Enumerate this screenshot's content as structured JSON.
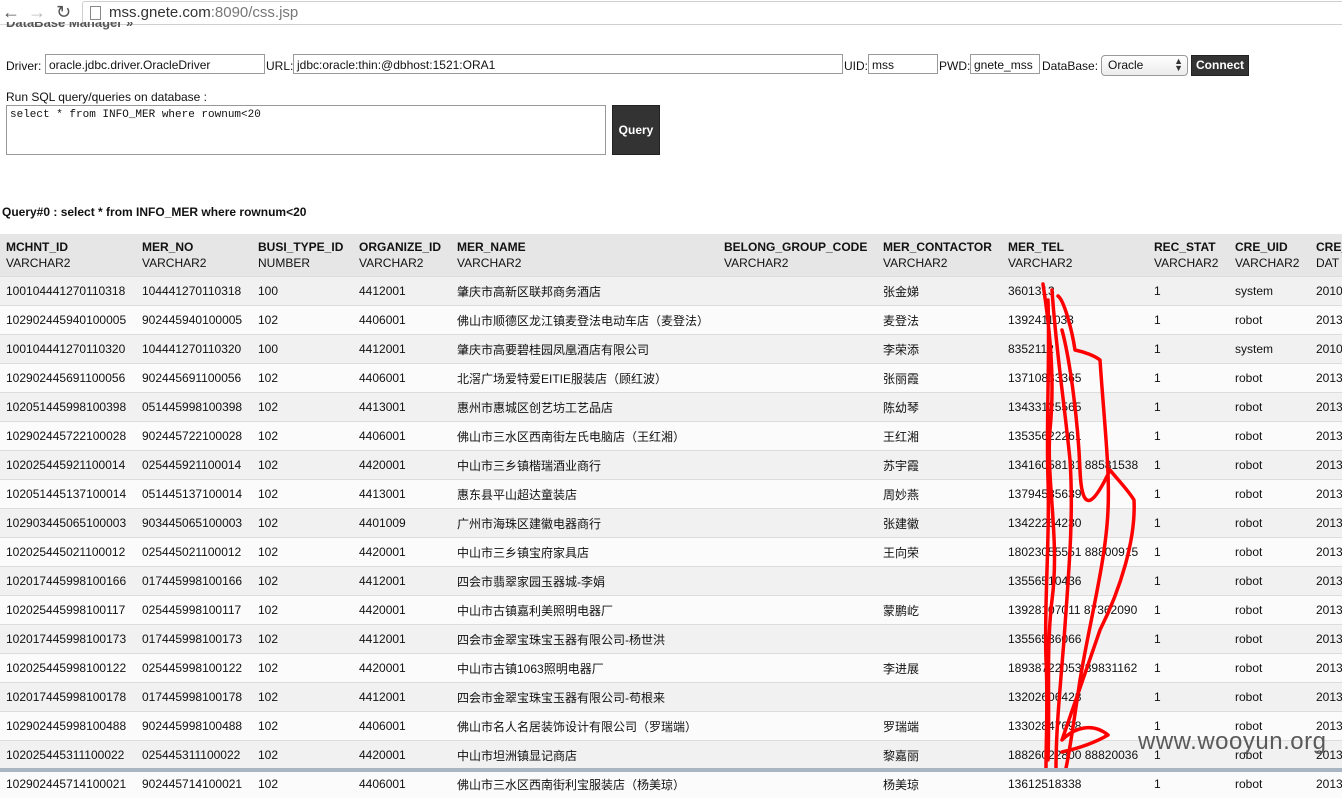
{
  "browser": {
    "url_host": "mss.gnete.com",
    "url_rest": ":8090/css.jsp",
    "back_icon": "back-arrow-icon",
    "forward_icon": "forward-arrow-icon",
    "reload_icon": "reload-icon"
  },
  "page": {
    "title": "DataBase Manager »"
  },
  "connection": {
    "driver_label": "Driver:",
    "driver_value": "oracle.jdbc.driver.OracleDriver",
    "url_label": "URL:",
    "url_value": "jdbc:oracle:thin:@dbhost:1521:ORA1",
    "uid_label": "UID:",
    "uid_value": "mss",
    "pwd_label": "PWD:",
    "pwd_value": "gnete_mss",
    "database_label": "DataBase:",
    "database_value": "Oracle",
    "connect_label": "Connect"
  },
  "query": {
    "label": "Run SQL query/queries on database :",
    "sql": "select * from INFO_MER where rownum<20",
    "button_label": "Query"
  },
  "result": {
    "title": "Query#0 : select * from INFO_MER where rownum<20",
    "columns": [
      {
        "name": "MCHNT_ID",
        "type": "VARCHAR2"
      },
      {
        "name": "MER_NO",
        "type": "VARCHAR2"
      },
      {
        "name": "BUSI_TYPE_ID",
        "type": "NUMBER"
      },
      {
        "name": "ORGANIZE_ID",
        "type": "VARCHAR2"
      },
      {
        "name": "MER_NAME",
        "type": "VARCHAR2"
      },
      {
        "name": "BELONG_GROUP_CODE",
        "type": "VARCHAR2"
      },
      {
        "name": "MER_CONTACTOR",
        "type": "VARCHAR2"
      },
      {
        "name": "MER_TEL",
        "type": "VARCHAR2"
      },
      {
        "name": "REC_STAT",
        "type": "VARCHAR2"
      },
      {
        "name": "CRE_UID",
        "type": "VARCHAR2"
      },
      {
        "name": "CRE_",
        "type": "DAT"
      }
    ],
    "rows": [
      [
        "100104441270110318",
        "104441270110318",
        "100",
        "4412001",
        "肇庆市高新区联邦商务酒店",
        "",
        "张金娣",
        "3601313",
        "1",
        "system",
        "2010"
      ],
      [
        "102902445940100005",
        "902445940100005",
        "102",
        "4406001",
        "佛山市顺德区龙江镇麦登法电动车店（麦登法）",
        "",
        "麦登法",
        "1392411033",
        "1",
        "robot",
        "2013"
      ],
      [
        "100104441270110320",
        "104441270110320",
        "100",
        "4412001",
        "肇庆市高要碧桂园凤凰酒店有限公司",
        "",
        "李荣添",
        "8352112",
        "1",
        "system",
        "2010"
      ],
      [
        "102902445691100056",
        "902445691100056",
        "102",
        "4406001",
        "北滘广场爱特爱EITIE服装店（顾红波）",
        "",
        "张丽霞",
        "13710833365",
        "1",
        "robot",
        "2013"
      ],
      [
        "102051445998100398",
        "051445998100398",
        "102",
        "4413001",
        "惠州市惠城区创艺坊工艺品店",
        "",
        "陈幼琴",
        "13433125565",
        "1",
        "robot",
        "2013"
      ],
      [
        "102902445722100028",
        "902445722100028",
        "102",
        "4406001",
        "佛山市三水区西南街左氏电脑店（王红湘）",
        "",
        "王红湘",
        "13535622261",
        "1",
        "robot",
        "2013"
      ],
      [
        "102025445921100014",
        "025445921100014",
        "102",
        "4420001",
        "中山市三乡镇楷瑞酒业商行",
        "",
        "苏宇霞",
        "13416058181 88581538",
        "1",
        "robot",
        "2013"
      ],
      [
        "102051445137100014",
        "051445137100014",
        "102",
        "4413001",
        "惠东县平山超达童装店",
        "",
        "周妙燕",
        "13794535639",
        "1",
        "robot",
        "2013"
      ],
      [
        "102903445065100003",
        "903445065100003",
        "102",
        "4401009",
        "广州市海珠区建徽电器商行",
        "",
        "张建徽",
        "13422264230",
        "1",
        "robot",
        "2013"
      ],
      [
        "102025445021100012",
        "025445021100012",
        "102",
        "4420001",
        "中山市三乡镇宝府家具店",
        "",
        "王向荣",
        "18023055551 88800915",
        "1",
        "robot",
        "2013"
      ],
      [
        "102017445998100166",
        "017445998100166",
        "102",
        "4412001",
        "四会市翡翠家园玉器城-李娟",
        "",
        "",
        "13556510436",
        "1",
        "robot",
        "2013"
      ],
      [
        "102025445998100117",
        "025445998100117",
        "102",
        "4420001",
        "中山市古镇嘉利美照明电器厂",
        "",
        "蒙鹏屹",
        "13928107011 87362090",
        "1",
        "robot",
        "2013"
      ],
      [
        "102017445998100173",
        "017445998100173",
        "102",
        "4412001",
        "四会市金翠宝珠宝玉器有限公司-杨世洪",
        "",
        "",
        "13556536066",
        "1",
        "robot",
        "2013"
      ],
      [
        "102025445998100122",
        "025445998100122",
        "102",
        "4420001",
        "中山市古镇1063照明电器厂",
        "",
        "李进展",
        "18938722053 89831162",
        "1",
        "robot",
        "2013"
      ],
      [
        "102017445998100178",
        "017445998100178",
        "102",
        "4412001",
        "四会市金翠宝珠宝玉器有限公司-苟根来",
        "",
        "",
        "13202606428",
        "1",
        "robot",
        "2013"
      ],
      [
        "102902445998100488",
        "902445998100488",
        "102",
        "4406001",
        "佛山市名人名居装饰设计有限公司（罗瑞端）",
        "",
        "罗瑞端",
        "13302847698",
        "1",
        "robot",
        "2013"
      ],
      [
        "102025445311100022",
        "025445311100022",
        "102",
        "4420001",
        "中山市坦洲镇显记商店",
        "",
        "黎嘉丽",
        "18826022800 88820036",
        "1",
        "robot",
        "2013"
      ],
      [
        "102902445714100021",
        "902445714100021",
        "102",
        "4406001",
        "佛山市三水区西南街利宝服装店（杨美琼）",
        "",
        "杨美琼",
        "13612518338",
        "1",
        "robot",
        "2013"
      ]
    ]
  },
  "watermark": "www.wooyun.org",
  "colors": {
    "button_bg": "#333333",
    "header_bg": "#e6e6e6",
    "scribble": "#ff0000"
  }
}
